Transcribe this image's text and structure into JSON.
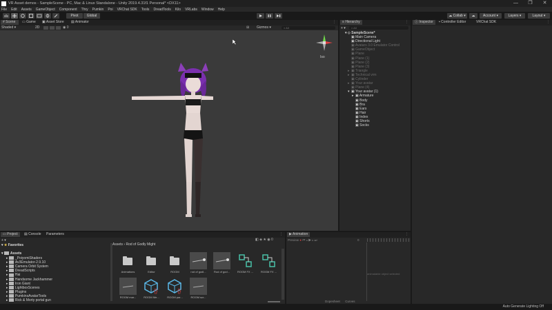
{
  "title_bar": {
    "text": "VR Asset demos - SampleScene - PC, Mac & Linux Standalone - Unity 2019.4.31f1 Personal* <DX11>",
    "controls": [
      "—",
      "❐",
      "✕"
    ]
  },
  "menu": [
    "File",
    "Edit",
    "Assets",
    "GameObject",
    "Component",
    "Thry",
    "Pumkin",
    "Poi",
    "VRChat SDK",
    "Tools",
    "DreadTools",
    "Kilo",
    "VRLabs",
    "Window",
    "Help"
  ],
  "toolbar": {
    "pivot": "Pivot",
    "global": "Global",
    "collab": "Collab",
    "account": "Account",
    "layers": "Layers",
    "layout": "Layout"
  },
  "scene_tabs": [
    "Scene",
    "Game",
    "Asset Store",
    "Animator"
  ],
  "scene_bar": {
    "shading": "Shaded",
    "mode_2d": "2D",
    "gizmos": "Gizmos",
    "search_placeholder": "All"
  },
  "gizmo": {
    "label": "Iso"
  },
  "hierarchy": {
    "tab": "Hierarchy",
    "search_placeholder": "All",
    "scene": "SampleScene*",
    "items": [
      {
        "label": "Main Camera",
        "depth": 1,
        "dim": false,
        "arrow": ""
      },
      {
        "label": "Directional Light",
        "depth": 1,
        "dim": false,
        "arrow": ""
      },
      {
        "label": "Avatars 3.0 Emulator Control",
        "depth": 1,
        "dim": true,
        "arrow": ""
      },
      {
        "label": "GameObject",
        "depth": 1,
        "dim": true,
        "arrow": ""
      },
      {
        "label": "Plane",
        "depth": 1,
        "dim": true,
        "arrow": ""
      },
      {
        "label": "Plane (1)",
        "depth": 1,
        "dim": true,
        "arrow": ""
      },
      {
        "label": "Plane (2)",
        "depth": 1,
        "dim": true,
        "arrow": ""
      },
      {
        "label": "Plane (3)",
        "depth": 1,
        "dim": true,
        "arrow": ""
      },
      {
        "label": "Triangle",
        "depth": 1,
        "dim": true,
        "arrow": "▸"
      },
      {
        "label": "Technical vrm",
        "depth": 1,
        "dim": true,
        "arrow": "▸"
      },
      {
        "label": "Cylinder",
        "depth": 1,
        "dim": true,
        "arrow": ""
      },
      {
        "label": "Your avatar",
        "depth": 1,
        "dim": true,
        "arrow": "▸"
      },
      {
        "label": "Plane (4)",
        "depth": 1,
        "dim": true,
        "arrow": ""
      },
      {
        "label": "Your avatar (1)",
        "depth": 1,
        "dim": false,
        "arrow": "▾"
      },
      {
        "label": "Armature",
        "depth": 2,
        "dim": false,
        "arrow": "▸"
      },
      {
        "label": "Body",
        "depth": 2,
        "dim": false,
        "arrow": ""
      },
      {
        "label": "Bra",
        "depth": 2,
        "dim": false,
        "arrow": ""
      },
      {
        "label": "Ears",
        "depth": 2,
        "dim": false,
        "arrow": ""
      },
      {
        "label": "Hair",
        "depth": 2,
        "dim": false,
        "arrow": ""
      },
      {
        "label": "Index",
        "depth": 2,
        "dim": false,
        "arrow": ""
      },
      {
        "label": "Shorts",
        "depth": 2,
        "dim": false,
        "arrow": ""
      },
      {
        "label": "Socks",
        "depth": 2,
        "dim": false,
        "arrow": ""
      }
    ]
  },
  "inspector_tabs": [
    "Inspector",
    "Controller Editor",
    "VRChat SDK"
  ],
  "bottom_tabs": [
    "Project",
    "Console",
    "Parameters"
  ],
  "project": {
    "favorites": "Favorites",
    "assets": "Assets",
    "folders": [
      "_PoiyomiShaders",
      "Av3Emulator-2.9.10",
      "Camera Orbit System",
      "DreadScripts",
      "Hai",
      "Handsome Jackhammer",
      "Iron Giant",
      "LightboxScenes",
      "Plugins",
      "PumkinsAvatarTools",
      "Rick & Morty portal gun"
    ],
    "breadcrumb": [
      "Assets",
      "Rod of Godly Might"
    ],
    "count": "0",
    "grid": [
      {
        "label": "Animations",
        "kind": "folder"
      },
      {
        "label": "Editor",
        "kind": "folder"
      },
      {
        "label": "ROGM",
        "kind": "folder"
      },
      {
        "label": "rod of godl...",
        "kind": "anim"
      },
      {
        "label": "Rod of god...",
        "kind": "anim"
      },
      {
        "label": "ROGM FX ...",
        "kind": "controller"
      },
      {
        "label": "ROGM FX ...",
        "kind": "controller"
      },
      {
        "label": "ROGM mar...",
        "kind": "material"
      },
      {
        "label": "ROGM Me...",
        "kind": "menu"
      },
      {
        "label": "ROGM par...",
        "kind": "params"
      },
      {
        "label": "ROGM scr...",
        "kind": "material"
      }
    ]
  },
  "animation": {
    "tab": "Animation",
    "preview": "Preview",
    "frame": "0",
    "empty_text": "animatable object selected",
    "dopesheet": "Dopesheet",
    "curves": "Curves"
  },
  "status": {
    "lighting": "Auto Generate Lighting Off"
  },
  "colors": {
    "accent": "#3e6fd8",
    "bg": "#191919",
    "panel": "#282828",
    "viewport": "#3a3a3a"
  }
}
